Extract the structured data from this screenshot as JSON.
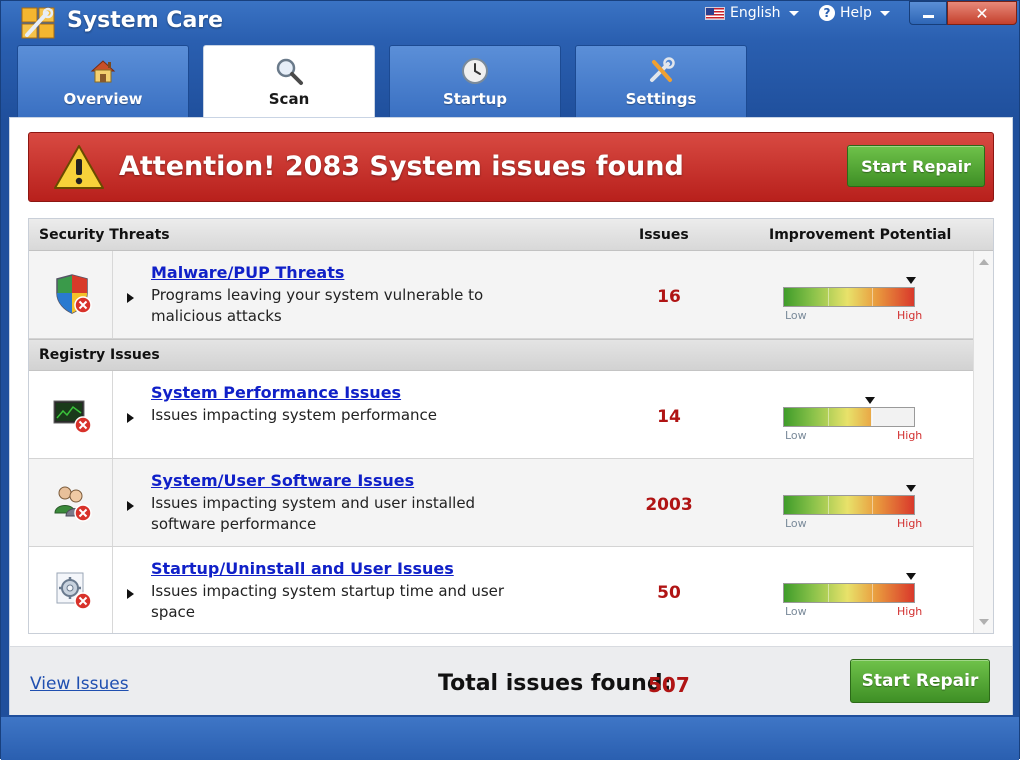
{
  "app": {
    "title": "System Care",
    "language": "English",
    "help": "Help",
    "close_glyph": "✕"
  },
  "tabs": [
    {
      "label": "Overview",
      "icon": "house-icon",
      "active": false
    },
    {
      "label": "Scan",
      "icon": "magnifier-icon",
      "active": true
    },
    {
      "label": "Startup",
      "icon": "clock-icon",
      "active": false
    },
    {
      "label": "Settings",
      "icon": "tools-icon",
      "active": false
    }
  ],
  "banner": {
    "title": "Attention! 2083 System issues found",
    "button": "Start Repair",
    "color": "#c8302a"
  },
  "table": {
    "columns": {
      "category": "Security Threats",
      "issues": "Issues",
      "potential": "Improvement Potential"
    },
    "section_registry": "Registry Issues",
    "meter_low": "Low",
    "meter_high": "High",
    "rows": [
      {
        "title": "Malware/PUP Threats",
        "desc": "Programs leaving your system vulnerable to malicious attacks",
        "count": "16",
        "icon": "shield-icon",
        "level": 1.0
      },
      {
        "title": "System Performance Issues",
        "desc": "Issues impacting system performance",
        "count": "14",
        "icon": "monitor-icon",
        "level": 0.66
      },
      {
        "title": "System/User Software Issues",
        "desc": "Issues impacting system and user installed software performance",
        "count": "2003",
        "icon": "users-icon",
        "level": 1.0
      },
      {
        "title": "Startup/Uninstall and User Issues",
        "desc": "Issues impacting system startup time and user space",
        "count": "50",
        "icon": "gear-icon",
        "level": 1.0
      }
    ]
  },
  "footer": {
    "view_issues": "View Issues",
    "total_label": "Total issues found:",
    "total_value": "507",
    "button": "Start Repair"
  },
  "colors": {
    "accent_blue": "#2a5fb0",
    "danger_red": "#b01414",
    "repair_green": "#4fa832",
    "link_blue": "#1020c8"
  }
}
